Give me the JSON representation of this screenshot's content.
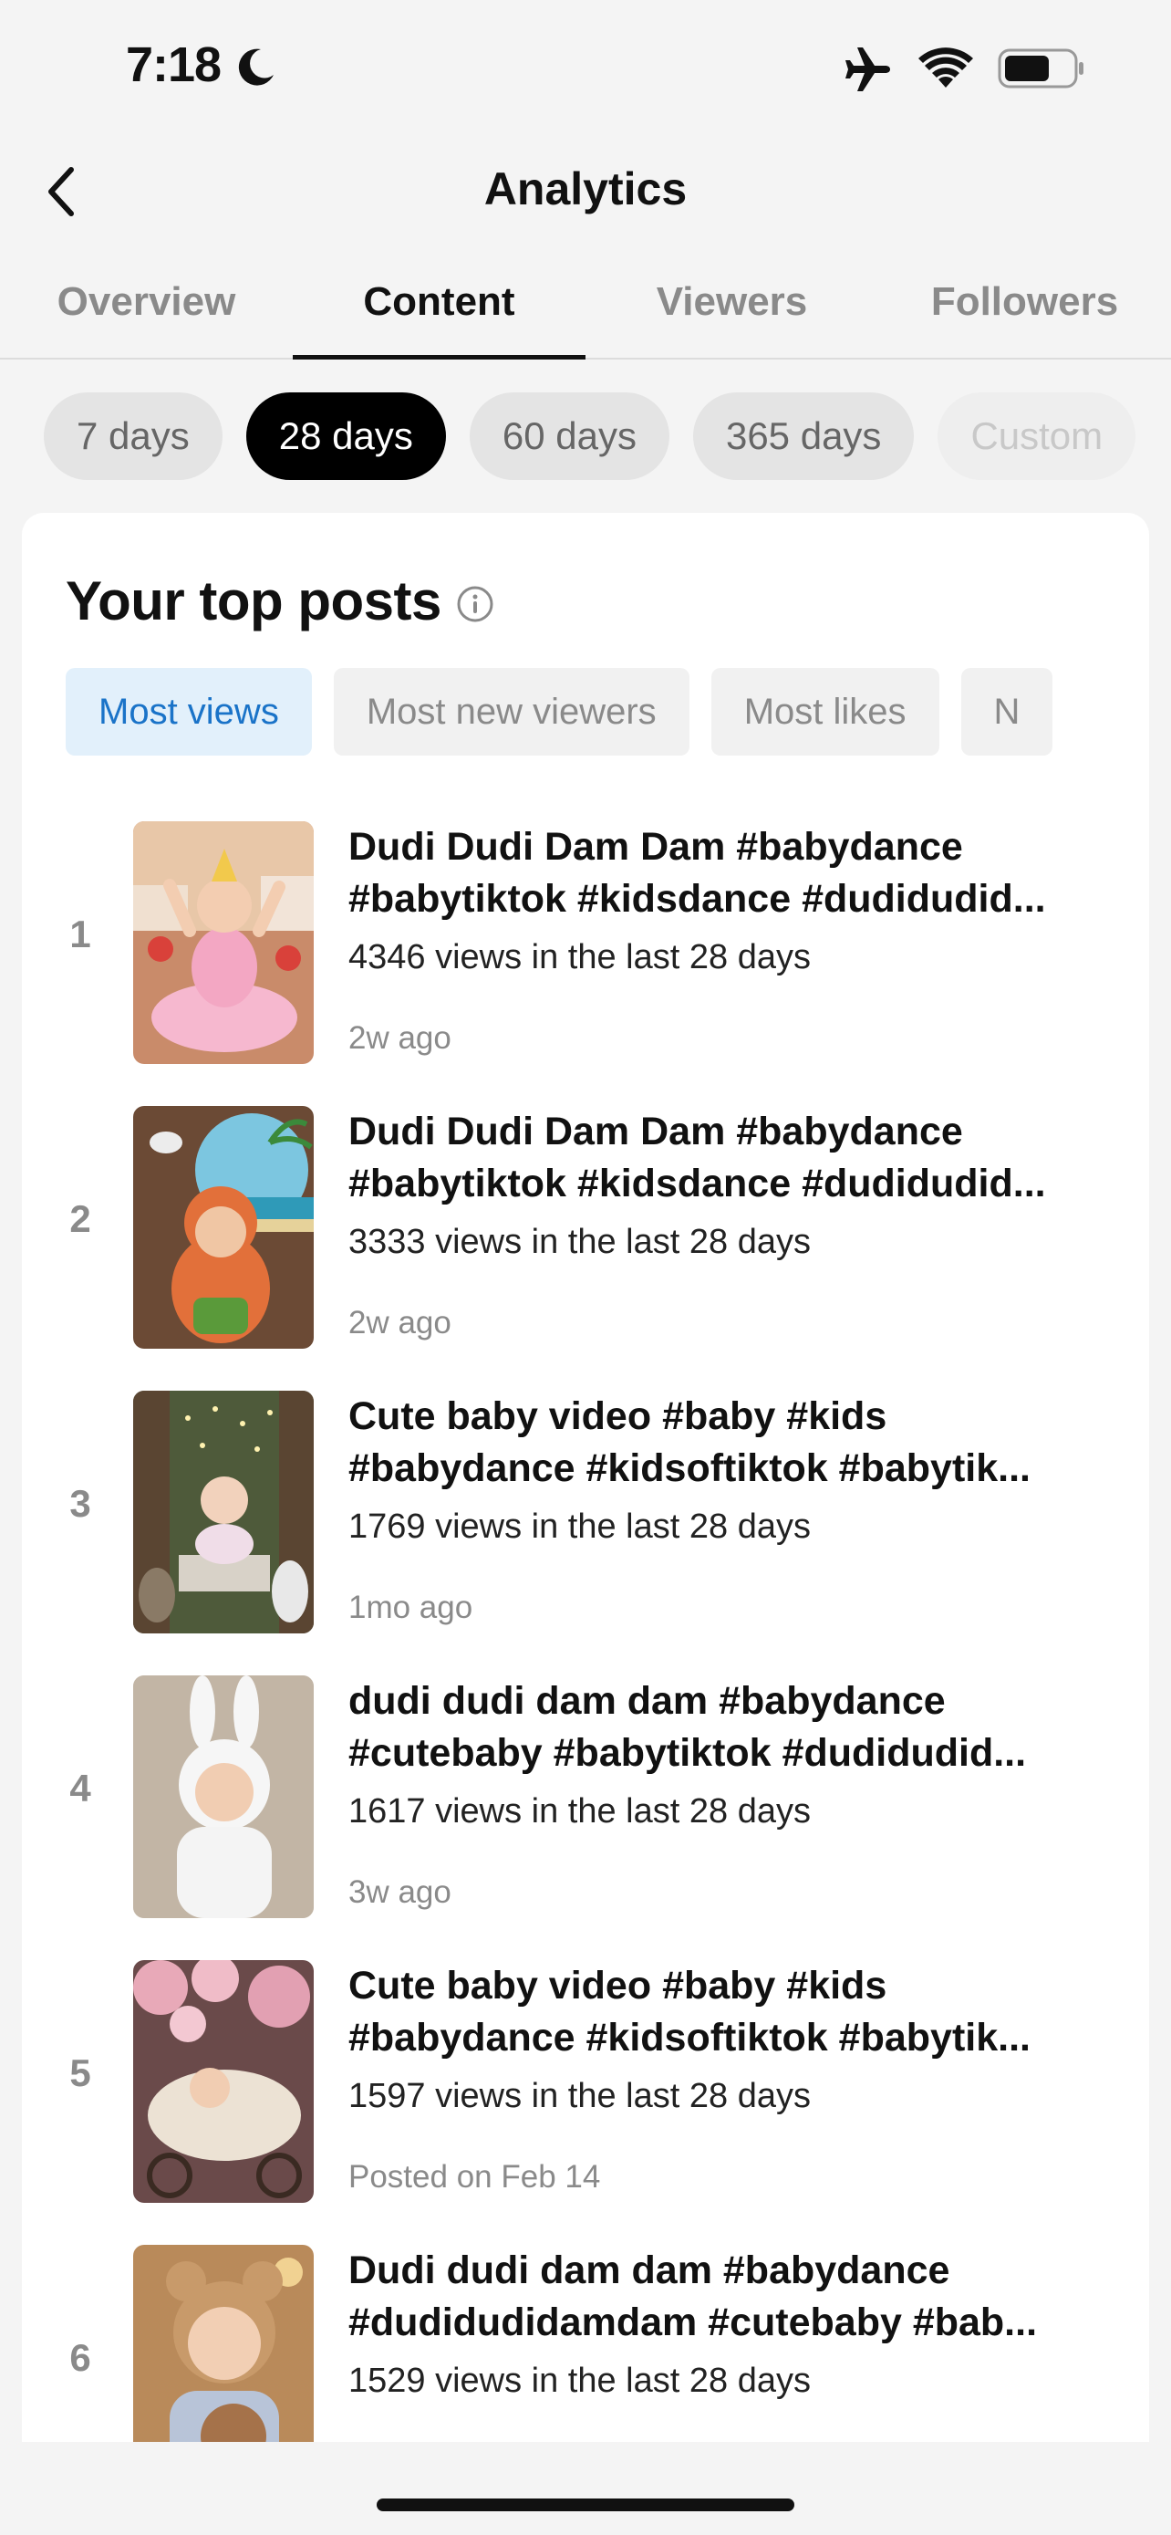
{
  "status_bar": {
    "time": "7:18",
    "icons": [
      "moon-icon",
      "airplane-icon",
      "wifi-icon",
      "battery-icon"
    ]
  },
  "nav": {
    "title": "Analytics",
    "back_icon": "chevron-left-icon"
  },
  "tabs": [
    {
      "label": "Overview",
      "active": false
    },
    {
      "label": "Content",
      "active": true
    },
    {
      "label": "Viewers",
      "active": false
    },
    {
      "label": "Followers",
      "active": false
    }
  ],
  "ranges": [
    {
      "label": "7 days",
      "active": false
    },
    {
      "label": "28 days",
      "active": true
    },
    {
      "label": "60 days",
      "active": false
    },
    {
      "label": "365 days",
      "active": false
    },
    {
      "label": "Custom",
      "active": false
    }
  ],
  "top_posts": {
    "title": "Your top posts",
    "info_icon": "info-icon",
    "filters": [
      {
        "label": "Most views",
        "active": true
      },
      {
        "label": "Most new viewers",
        "active": false
      },
      {
        "label": "Most likes",
        "active": false
      },
      {
        "label": "N",
        "active": false
      }
    ],
    "posts": [
      {
        "rank": "1",
        "title_line1": "Dudi Dudi Dam Dam #babydance",
        "title_line2": "#babytiktok #kidsdance #dudidudid...",
        "views": "4346 views in the last 28 days",
        "age": "2w ago"
      },
      {
        "rank": "2",
        "title_line1": "Dudi Dudi Dam Dam #babydance",
        "title_line2": "#babytiktok #kidsdance #dudidudid...",
        "views": "3333 views in the last 28 days",
        "age": "2w ago"
      },
      {
        "rank": "3",
        "title_line1": "Cute baby video #baby #kids",
        "title_line2": "#babydance #kidsoftiktok #babytik...",
        "views": "1769 views in the last 28 days",
        "age": "1mo ago"
      },
      {
        "rank": "4",
        "title_line1": "dudi dudi dam dam #babydance",
        "title_line2": "#cutebaby #babytiktok #dudidudid...",
        "views": "1617 views in the last 28 days",
        "age": "3w ago"
      },
      {
        "rank": "5",
        "title_line1": "Cute baby video #baby #kids",
        "title_line2": "#babydance #kidsoftiktok #babytik...",
        "views": "1597 views in the last 28 days",
        "age": "Posted on Feb 14"
      },
      {
        "rank": "6",
        "title_line1": "Dudi dudi dam dam #babydance",
        "title_line2": "#dudidudidamdam #cutebaby #bab...",
        "views": "1529 views in the last 28 days",
        "age": ""
      }
    ]
  }
}
